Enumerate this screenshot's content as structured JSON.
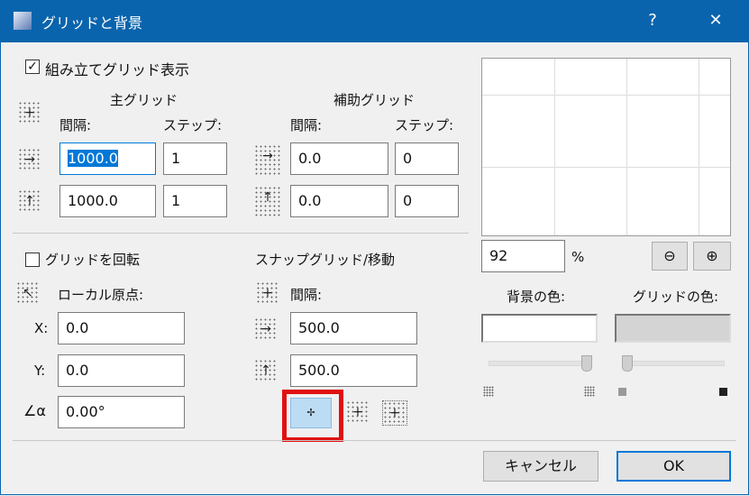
{
  "window": {
    "title": "グリッドと背景",
    "help": "?",
    "close": "✕"
  },
  "construction": {
    "show_label": "組み立てグリッド表示",
    "show_checked": true,
    "main": {
      "heading": "主グリッド",
      "spacing_label": "間隔:",
      "step_label": "ステップ:",
      "x_spacing": "1000.0",
      "x_step": "1",
      "y_spacing": "1000.0",
      "y_step": "1"
    },
    "aux": {
      "heading": "補助グリッド",
      "spacing_label": "間隔:",
      "step_label": "ステップ:",
      "x_spacing": "0.0",
      "x_step": "0",
      "y_spacing": "0.0",
      "y_step": "0"
    }
  },
  "rotate": {
    "label": "グリッドを回転",
    "checked": false,
    "origin_label": "ローカル原点:",
    "x_label": "X:",
    "x": "0.0",
    "y_label": "Y:",
    "y": "0.0",
    "angle": "0.00°"
  },
  "snap": {
    "heading": "スナップグリッド/移動",
    "spacing_label": "間隔:",
    "x": "500.0",
    "y": "500.0"
  },
  "preview": {
    "zoom": "92",
    "zoom_unit": "%",
    "bg_color_label": "背景の色:",
    "grid_color_label": "グリッドの色:",
    "bg_color": "#ffffff",
    "grid_color": "#d4d4d4",
    "bg_slider": 1.0,
    "grid_slider": 0.0
  },
  "buttons": {
    "cancel": "キャンセル",
    "ok": "OK"
  }
}
